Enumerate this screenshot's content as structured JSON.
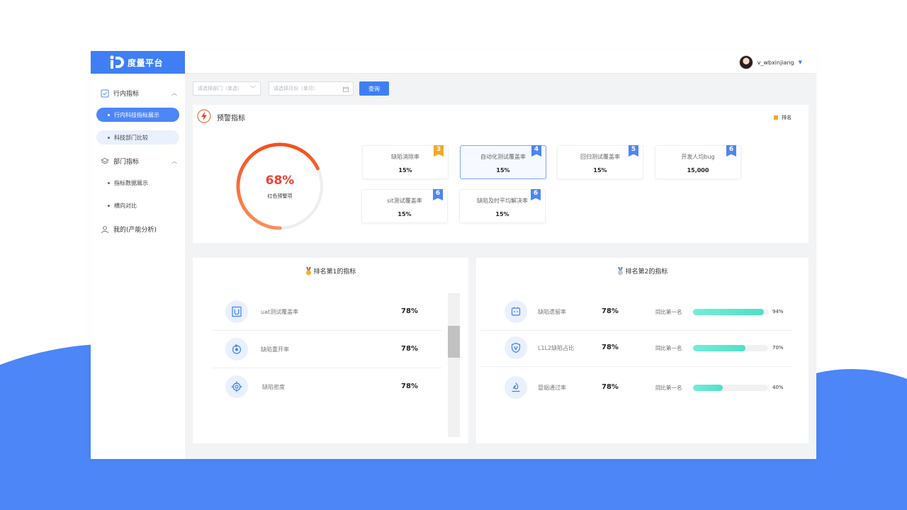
{
  "app": {
    "name": "度量平台",
    "user": "v_wbxinjiang"
  },
  "sidebar": {
    "groups": [
      {
        "label": "行内指标"
      },
      {
        "label": "部门指标"
      },
      {
        "label": "我的(产能分析)"
      }
    ],
    "items": [
      {
        "label": "行内科技指标展示"
      },
      {
        "label": "科技部门比较"
      },
      {
        "label": "指标数据展示"
      },
      {
        "label": "横向对比"
      }
    ]
  },
  "filters": {
    "dept_placeholder": "请选择部门（单选）",
    "month_placeholder": "请选择月份（单月）",
    "query_label": "查询"
  },
  "warning": {
    "title": "预警指标",
    "legend": "排名",
    "gauge_value": "68%",
    "gauge_fraction": 0.68,
    "gauge_label": "红色预警项",
    "cards": [
      {
        "name": "缺陷消除率",
        "value": "15%",
        "rank": "3",
        "rank_color": "#f2a826"
      },
      {
        "name": "自动化测试覆盖率",
        "value": "15%",
        "rank": "4",
        "rank_color": "#4c86f7"
      },
      {
        "name": "回归测试覆盖率",
        "value": "15%",
        "rank": "5",
        "rank_color": "#4c86f7"
      },
      {
        "name": "开发人均bug",
        "value": "15,000",
        "rank": "6",
        "rank_color": "#4c86f7"
      },
      {
        "name": "sit测试覆盖率",
        "value": "15%",
        "rank": "6",
        "rank_color": "#4c86f7"
      },
      {
        "name": "缺陷及时平均解决率",
        "value": "15%",
        "rank": "6",
        "rank_color": "#4c86f7"
      }
    ]
  },
  "rank1": {
    "title": "排名第1的指标",
    "rows": [
      {
        "name": "uat测试覆盖率",
        "value": "78%",
        "icon": "u-letter-icon"
      },
      {
        "name": "缺陷重开率",
        "value": "78%",
        "icon": "reopen-icon"
      },
      {
        "name": "缺陷密度",
        "value": "78%",
        "icon": "target-icon"
      }
    ]
  },
  "rank2": {
    "title": "排名第2的指标",
    "compare_label": "同比第一名",
    "rows": [
      {
        "name": "缺陷遗留率",
        "value": "78%",
        "pct": "94%",
        "fraction": 0.94,
        "icon": "bot-icon"
      },
      {
        "name": "L1L2缺陷占比",
        "value": "78%",
        "pct": "70%",
        "fraction": 0.7,
        "icon": "shield-icon"
      },
      {
        "name": "冒烟通过率",
        "value": "78%",
        "pct": "40%",
        "fraction": 0.4,
        "icon": "flame-icon"
      }
    ]
  },
  "colors": {
    "accent": "#3f7ff6",
    "warning": "#f04134",
    "bar": "#4ee0c6",
    "rank_orange": "#f2a826"
  }
}
